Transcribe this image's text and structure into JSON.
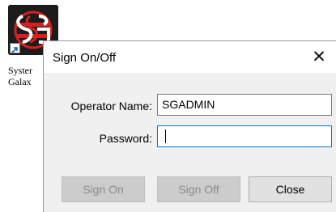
{
  "desktop": {
    "shortcut_label_line1": "Syster",
    "shortcut_label_line2": "Galax"
  },
  "dialog": {
    "title": "Sign On/Off",
    "close_glyph": "✕",
    "operator_label": "Operator Name:",
    "operator_value": "SGADMIN",
    "password_label": "Password:",
    "password_value": "",
    "buttons": {
      "sign_on": "Sign On",
      "sign_off": "Sign Off",
      "close": "Close"
    }
  },
  "colors": {
    "focus_border": "#0078d7",
    "disabled_text": "#8a8a8a",
    "logo_red": "#d62020"
  }
}
